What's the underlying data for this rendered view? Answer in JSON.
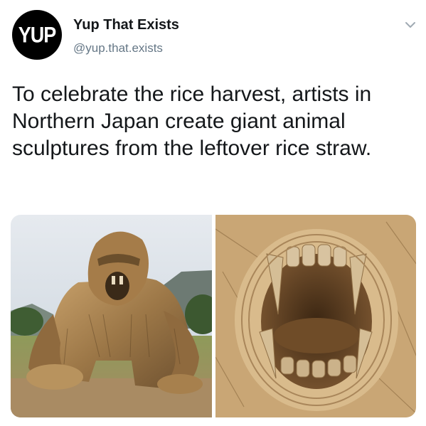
{
  "tweet": {
    "avatar_text": "YUP",
    "display_name": "Yup That Exists",
    "handle": "@yup.that.exists",
    "text": "To celebrate the rice harvest, artists in Northern Japan create giant animal sculptures from the leftover rice straw."
  },
  "icons": {
    "menu": "chevron-down-icon"
  },
  "colors": {
    "text": "#14171a",
    "secondary": "#657786",
    "avatar_bg": "#000000"
  }
}
